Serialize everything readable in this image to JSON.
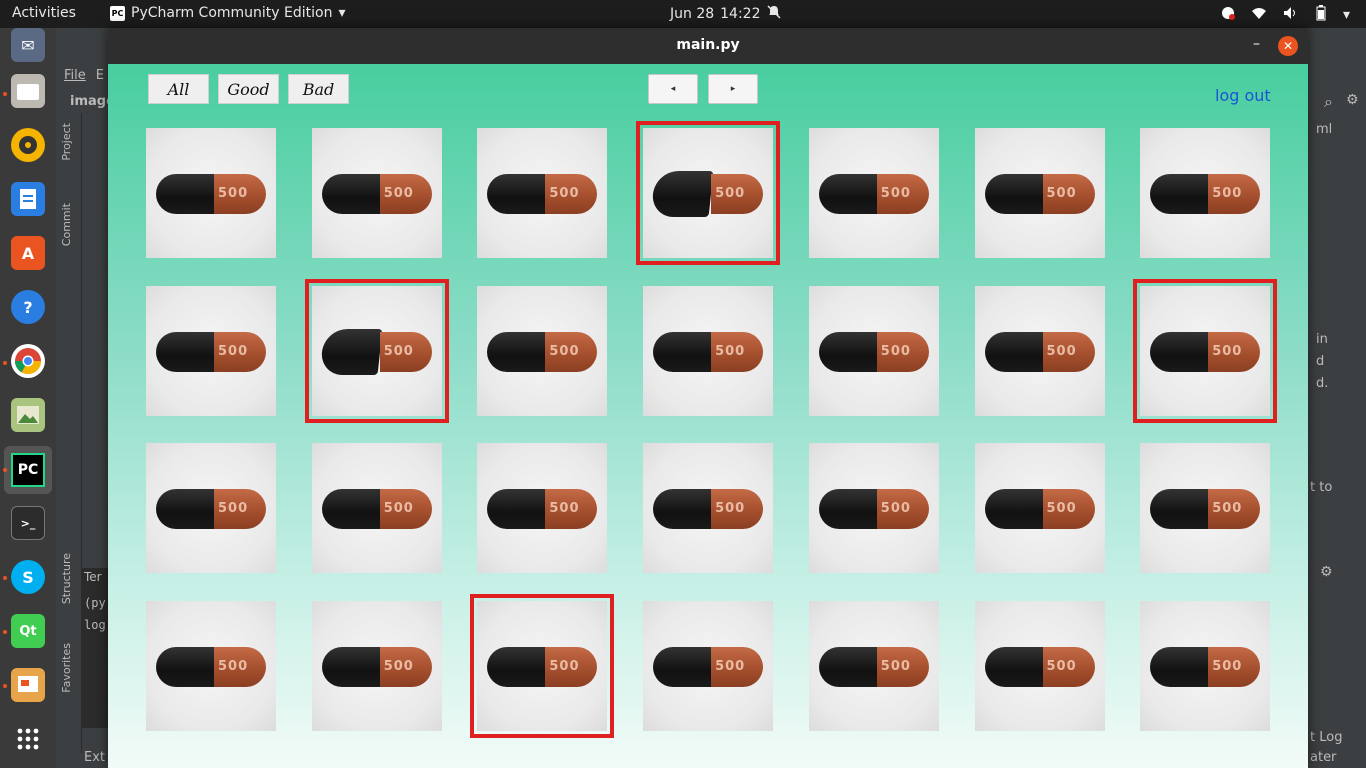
{
  "topbar": {
    "activities": "Activities",
    "app_name": "PyCharm Community Edition",
    "app_badge": "PC",
    "date": "Jun 28",
    "time": "14:22"
  },
  "ide": {
    "menu_file": "File",
    "menu_edit": "E",
    "project_label": "image",
    "tab_project": "Project",
    "tab_commit": "Commit",
    "tab_structure": "Structure",
    "tab_favorites": "Favorites",
    "terminal_label": "Ter",
    "terminal_line1": "(py",
    "terminal_line2": "log",
    "status_left": "Ext",
    "right_tab": "ml",
    "right_text_1": "in",
    "right_text_2": "d",
    "right_text_3": "d.",
    "right_text_4": "t to",
    "right_log": "t Log",
    "right_ater": "ater"
  },
  "window": {
    "title": "main.py",
    "min_glyph": "–",
    "close_glyph": "✕"
  },
  "toolbar": {
    "all": "All",
    "good": "Good",
    "bad": "Bad",
    "prev": "◂",
    "next": "▸",
    "logout": "log out"
  },
  "grid": {
    "capsule_text": "500",
    "rows": 4,
    "cols": 7,
    "flagged_bad": [
      [
        0,
        3
      ],
      [
        1,
        1
      ],
      [
        1,
        6
      ],
      [
        3,
        2
      ]
    ],
    "deformed": [
      [
        0,
        3
      ],
      [
        1,
        1
      ]
    ]
  }
}
